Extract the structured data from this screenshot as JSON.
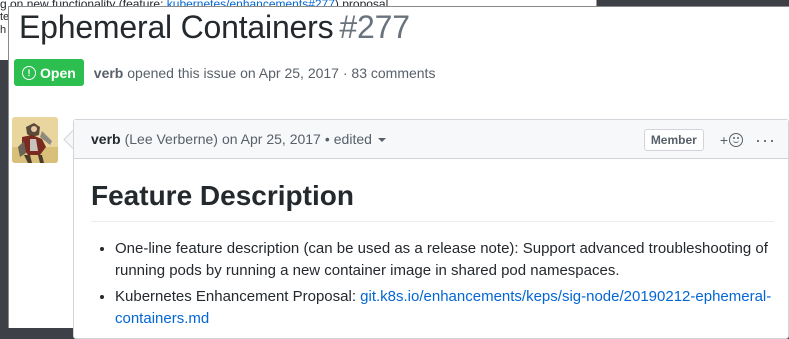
{
  "background": {
    "top_line_text": "g on new functionality (feature: ",
    "top_line_link": "kubernetes/enhancements#277",
    "top_line_suffix": ") proposal.",
    "fragment_1": "te",
    "fragment_2": "h"
  },
  "issue": {
    "title": "Ephemeral Containers",
    "number": "#277",
    "state_label": "Open",
    "state_icon": "alert-circle-icon",
    "author": "verb",
    "opened_text": "opened this issue on Apr 25, 2017 · 83 comments"
  },
  "comment": {
    "author": "verb",
    "author_full": "(Lee Verberne)",
    "date": "on Apr 25, 2017",
    "separator": "•",
    "edited_label": "edited",
    "member_badge": "Member",
    "reaction_plus": "+",
    "more_label": "···",
    "heading": "Feature Description",
    "items": [
      {
        "text": "One-line feature description (can be used as a release note): Support advanced troubleshooting of running pods by running a new container image in shared pod namespaces.",
        "link": ""
      },
      {
        "text": "Kubernetes Enhancement Proposal: ",
        "link": "git.k8s.io/enhancements/keps/sig-node/20190212-ephemeral-containers.md"
      }
    ]
  },
  "colors": {
    "open_green": "#2cbe4e",
    "link_blue": "#0366d6",
    "text_dark": "#24292e",
    "text_muted": "#586069"
  }
}
